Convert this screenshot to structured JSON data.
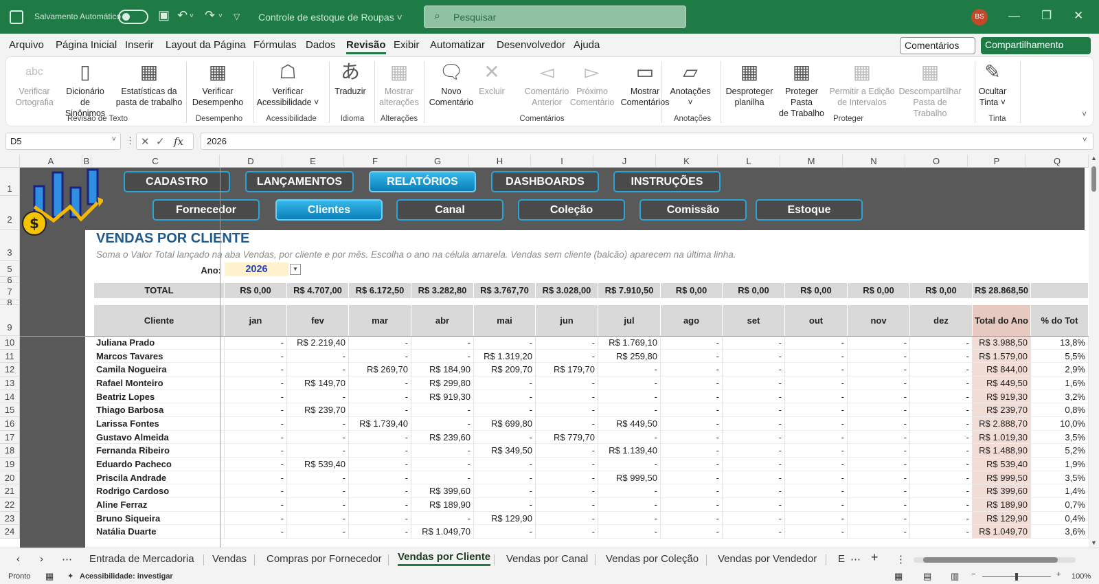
{
  "titlebar": {
    "autosave_label": "Salvamento Automático",
    "doc_name": "Controle de estoque de Roupas",
    "search_placeholder": "Pesquisar",
    "avatar": "BS"
  },
  "menu": [
    "Arquivo",
    "Página Inicial",
    "Inserir",
    "Layout da Página",
    "Fórmulas",
    "Dados",
    "Revisão",
    "Exibir",
    "Automatizar",
    "Desenvolvedor",
    "Ajuda"
  ],
  "menu_active": "Revisão",
  "comments_button": "Comentários",
  "share_button": "Compartilhamento",
  "ribbon": {
    "buttons": [
      {
        "l1": "Verificar",
        "l2": "Ortografia",
        "icon": "abc",
        "disabled": true
      },
      {
        "l1": "Dicionário",
        "l2": "de Sinônimos",
        "icon": "book",
        "disabled": false
      },
      {
        "l1": "Estatísticas da",
        "l2": "pasta de trabalho",
        "icon": "123",
        "disabled": false
      },
      {
        "l1": "Verificar",
        "l2": "Desempenho",
        "icon": "grid-clock",
        "disabled": false
      },
      {
        "l1": "Verificar",
        "l2": "Acessibilidade ˅",
        "icon": "accessibility",
        "disabled": false
      },
      {
        "l1": "Traduzir",
        "l2": "",
        "icon": "translate",
        "disabled": false
      },
      {
        "l1": "Mostrar",
        "l2": "alterações",
        "icon": "changes",
        "disabled": true
      },
      {
        "l1": "Novo",
        "l2": "Comentário",
        "icon": "new-comment",
        "disabled": false
      },
      {
        "l1": "Excluir",
        "l2": "",
        "icon": "delete-comment",
        "disabled": true
      },
      {
        "l1": "Comentário",
        "l2": "Anterior",
        "icon": "prev-comment",
        "disabled": true
      },
      {
        "l1": "Próximo",
        "l2": "Comentário",
        "icon": "next-comment",
        "disabled": true
      },
      {
        "l1": "Mostrar",
        "l2": "Comentários",
        "icon": "show-comments",
        "disabled": false
      },
      {
        "l1": "Anotações",
        "l2": "˅",
        "icon": "notes",
        "disabled": false
      },
      {
        "l1": "Desproteger",
        "l2": "planilha",
        "icon": "unprotect",
        "disabled": false
      },
      {
        "l1": "Proteger Pasta",
        "l2": "de Trabalho",
        "icon": "protect",
        "disabled": false
      },
      {
        "l1": "Permitir a Edição",
        "l2": "de Intervalos",
        "icon": "allow-edit",
        "disabled": true
      },
      {
        "l1": "Descompartilhar",
        "l2": "Pasta de Trabalho",
        "icon": "unshare",
        "disabled": true
      },
      {
        "l1": "Ocultar",
        "l2": "Tinta ˅",
        "icon": "ink",
        "disabled": false
      }
    ],
    "groups": [
      "Revisão de Texto",
      "Desempenho",
      "Acessibilidade",
      "Idioma",
      "Alterações",
      "Comentários",
      "Anotações",
      "Proteger",
      "Tinta"
    ]
  },
  "formula_bar": {
    "name_box": "D5",
    "fx": "fx",
    "value": "2026"
  },
  "columns": [
    "A",
    "B",
    "C",
    "D",
    "E",
    "F",
    "G",
    "H",
    "I",
    "J",
    "K",
    "L",
    "M",
    "N",
    "O",
    "P",
    "Q"
  ],
  "rows": [
    "1",
    "2",
    "3",
    "5",
    "6",
    "7",
    "8",
    "9",
    "10",
    "11",
    "12",
    "13",
    "14",
    "15",
    "16",
    "17",
    "18",
    "19",
    "20",
    "21",
    "22",
    "23",
    "24"
  ],
  "nav_top": [
    "CADASTRO",
    "LANÇAMENTOS",
    "RELATÓRIOS",
    "DASHBOARDS",
    "INSTRUÇÕES"
  ],
  "nav_top_active": "RELATÓRIOS",
  "nav_sub": [
    "Fornecedor",
    "Clientes",
    "Canal",
    "Coleção",
    "Comissão",
    "Estoque"
  ],
  "nav_sub_active": "Clientes",
  "report": {
    "title": "VENDAS POR CLIENTE",
    "subtitle": "Soma o Valor Total lançado na aba Vendas, por cliente e por mês. Escolha o ano na célula amarela. Vendas sem cliente (balcão) aparecem na última linha.",
    "year_label": "Ano:",
    "year": "2026"
  },
  "table": {
    "total_label": "TOTAL",
    "totals": [
      "R$ 0,00",
      "R$ 4.707,00",
      "R$ 6.172,50",
      "R$ 3.282,80",
      "R$ 3.767,70",
      "R$ 3.028,00",
      "R$ 7.910,50",
      "R$ 0,00",
      "R$ 0,00",
      "R$ 0,00",
      "R$ 0,00",
      "R$ 0,00",
      "R$ 28.868,50"
    ],
    "headers": [
      "Cliente",
      "jan",
      "fev",
      "mar",
      "abr",
      "mai",
      "jun",
      "jul",
      "ago",
      "set",
      "out",
      "nov",
      "dez",
      "Total do Ano",
      "% do Tot"
    ],
    "rows": [
      [
        "Juliana Prado",
        "-",
        "R$ 2.219,40",
        "-",
        "-",
        "-",
        "-",
        "R$ 1.769,10",
        "-",
        "-",
        "-",
        "-",
        "-",
        "R$ 3.988,50",
        "13,8%"
      ],
      [
        "Marcos Tavares",
        "-",
        "-",
        "-",
        "-",
        "R$ 1.319,20",
        "-",
        "R$ 259,80",
        "-",
        "-",
        "-",
        "-",
        "-",
        "R$ 1.579,00",
        "5,5%"
      ],
      [
        "Camila Nogueira",
        "-",
        "-",
        "R$ 269,70",
        "R$ 184,90",
        "R$ 209,70",
        "R$ 179,70",
        "-",
        "-",
        "-",
        "-",
        "-",
        "-",
        "R$ 844,00",
        "2,9%"
      ],
      [
        "Rafael Monteiro",
        "-",
        "R$ 149,70",
        "-",
        "R$ 299,80",
        "-",
        "-",
        "-",
        "-",
        "-",
        "-",
        "-",
        "-",
        "R$ 449,50",
        "1,6%"
      ],
      [
        "Beatriz Lopes",
        "-",
        "-",
        "-",
        "R$ 919,30",
        "-",
        "-",
        "-",
        "-",
        "-",
        "-",
        "-",
        "-",
        "R$ 919,30",
        "3,2%"
      ],
      [
        "Thiago Barbosa",
        "-",
        "R$ 239,70",
        "-",
        "-",
        "-",
        "-",
        "-",
        "-",
        "-",
        "-",
        "-",
        "-",
        "R$ 239,70",
        "0,8%"
      ],
      [
        "Larissa Fontes",
        "-",
        "-",
        "R$ 1.739,40",
        "-",
        "R$ 699,80",
        "-",
        "R$ 449,50",
        "-",
        "-",
        "-",
        "-",
        "-",
        "R$ 2.888,70",
        "10,0%"
      ],
      [
        "Gustavo Almeida",
        "-",
        "-",
        "-",
        "R$ 239,60",
        "-",
        "R$ 779,70",
        "-",
        "-",
        "-",
        "-",
        "-",
        "-",
        "R$ 1.019,30",
        "3,5%"
      ],
      [
        "Fernanda Ribeiro",
        "-",
        "-",
        "-",
        "-",
        "R$ 349,50",
        "-",
        "R$ 1.139,40",
        "-",
        "-",
        "-",
        "-",
        "-",
        "R$ 1.488,90",
        "5,2%"
      ],
      [
        "Eduardo Pacheco",
        "-",
        "R$ 539,40",
        "-",
        "-",
        "-",
        "-",
        "-",
        "-",
        "-",
        "-",
        "-",
        "-",
        "R$ 539,40",
        "1,9%"
      ],
      [
        "Priscila Andrade",
        "-",
        "-",
        "-",
        "-",
        "-",
        "-",
        "R$ 999,50",
        "-",
        "-",
        "-",
        "-",
        "-",
        "R$ 999,50",
        "3,5%"
      ],
      [
        "Rodrigo Cardoso",
        "-",
        "-",
        "-",
        "R$ 399,60",
        "-",
        "-",
        "-",
        "-",
        "-",
        "-",
        "-",
        "-",
        "R$ 399,60",
        "1,4%"
      ],
      [
        "Aline Ferraz",
        "-",
        "-",
        "-",
        "R$ 189,90",
        "-",
        "-",
        "-",
        "-",
        "-",
        "-",
        "-",
        "-",
        "R$ 189,90",
        "0,7%"
      ],
      [
        "Bruno Siqueira",
        "-",
        "-",
        "-",
        "-",
        "R$ 129,90",
        "-",
        "-",
        "-",
        "-",
        "-",
        "-",
        "-",
        "R$ 129,90",
        "0,4%"
      ],
      [
        "Natália Duarte",
        "-",
        "-",
        "-",
        "R$ 1.049,70",
        "-",
        "-",
        "-",
        "-",
        "-",
        "-",
        "-",
        "-",
        "R$ 1.049,70",
        "3,6%"
      ]
    ]
  },
  "tabs": [
    "Entrada de Mercadoria",
    "Vendas",
    "Compras por Fornecedor",
    "Vendas por Cliente",
    "Vendas por Canal",
    "Vendas por Coleção",
    "Vendas por Vendedor",
    "E"
  ],
  "tab_active": "Vendas por Cliente",
  "status": {
    "ready": "Pronto",
    "accessibility": "Acessibilidade: investigar",
    "zoom": "100%"
  }
}
